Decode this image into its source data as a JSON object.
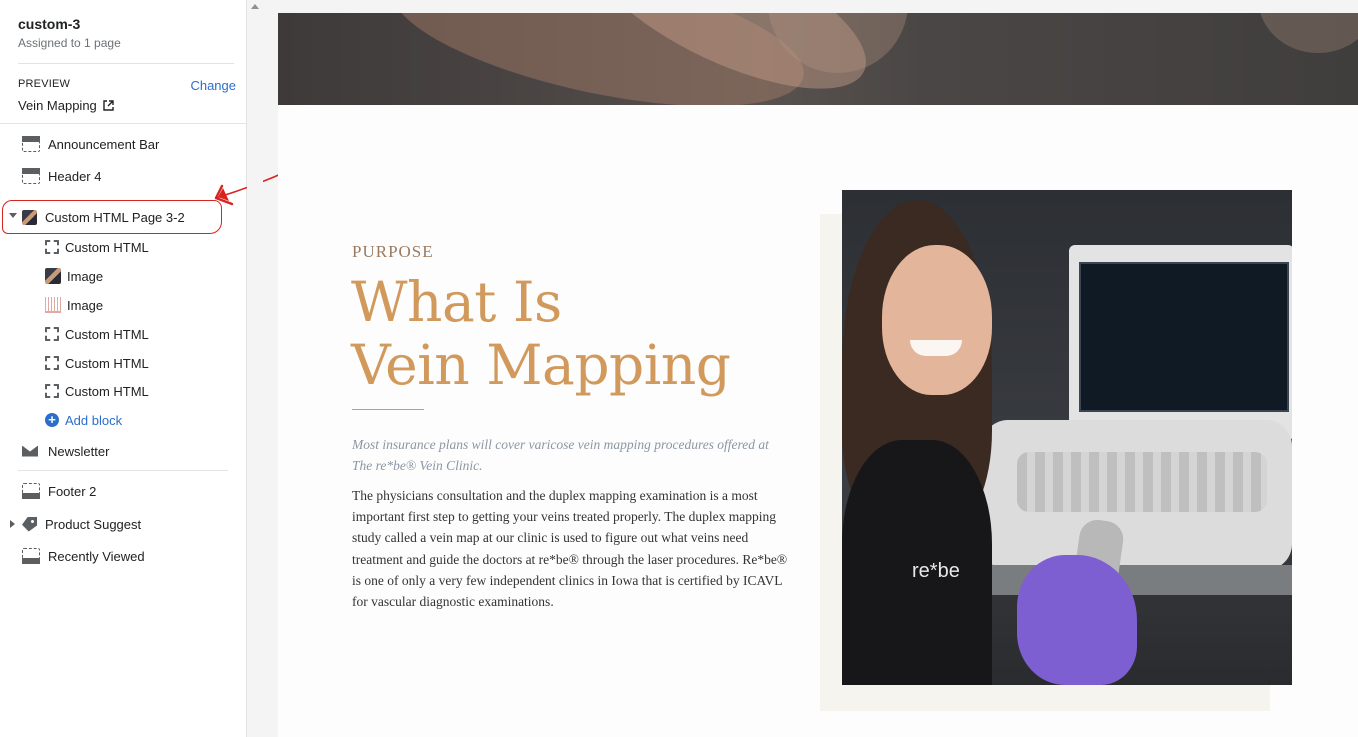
{
  "sidebar": {
    "template_name": "custom-3",
    "template_subtitle": "Assigned to 1 page",
    "preview_label": "PREVIEW",
    "preview_change": "Change",
    "preview_page": "Vein Mapping",
    "sections": [
      {
        "label": "Announcement Bar",
        "icon": "header-section-icon"
      },
      {
        "label": "Header 4",
        "icon": "header-section-icon"
      },
      {
        "label": "Custom HTML Page 3-2",
        "icon": "image-thumbnail-icon",
        "expanded": true
      },
      {
        "label": "Newsletter",
        "icon": "envelope-icon"
      },
      {
        "label": "Footer 2",
        "icon": "footer-section-icon"
      },
      {
        "label": "Product Suggest",
        "icon": "tag-icon",
        "expanded": false
      },
      {
        "label": "Recently Viewed",
        "icon": "footer-section-icon"
      }
    ],
    "blocks": [
      {
        "label": "Custom HTML",
        "icon": "dashed-frame-icon"
      },
      {
        "label": "Image",
        "icon": "image-thumbnail-icon"
      },
      {
        "label": "Image",
        "icon": "image-thumbnail-icon"
      },
      {
        "label": "Custom HTML",
        "icon": "dashed-frame-icon"
      },
      {
        "label": "Custom HTML",
        "icon": "dashed-frame-icon"
      },
      {
        "label": "Custom HTML",
        "icon": "dashed-frame-icon"
      }
    ],
    "add_block": "Add block"
  },
  "content": {
    "eyebrow": "PURPOSE",
    "title_line1": "What Is",
    "title_line2": "Vein Mapping",
    "lede": "Most insurance plans will cover varicose vein mapping procedures offered at The re*be® Vein Clinic.",
    "body": "The physicians consultation and the duplex mapping examination is a most important first step to getting your veins treated properly. The duplex mapping study called a vein map at our clinic is used to figure out what veins need treatment and guide the doctors at re*be® through the laser procedures. Re*be® is one of only a very few independent clinics in Iowa that is certified by ICAVL for vascular diagnostic examinations.",
    "photo_logo": "re*be"
  },
  "colors": {
    "accent_link": "#2c6ecb",
    "annotation_red": "#d9231f",
    "heading_gold": "#d19a5c",
    "lede_gray": "#8b96a3"
  }
}
